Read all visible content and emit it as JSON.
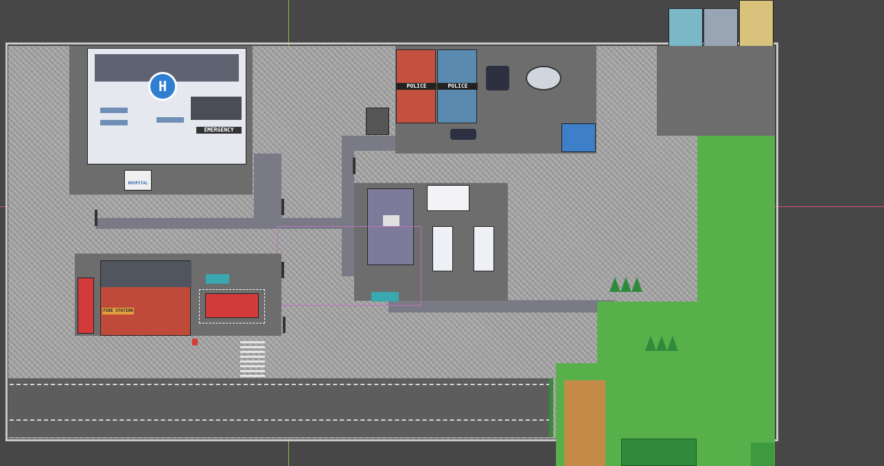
{
  "editor": {
    "canvas_bg": "#474747",
    "cursor_h_color": "#e0507a",
    "cursor_v_color": "#8ac24a"
  },
  "map": {
    "signs": {
      "hospital_helipad": "H",
      "emergency": "EMERGENCY",
      "hospital": "HOSPITAL",
      "police_left": "POLICE",
      "police_right": "POLICE",
      "fire_station": "FIRE STATION"
    },
    "icons": [
      "helicopter-icon",
      "mailbox-icon",
      "fire-hydrant-icon",
      "street-lamp-icon",
      "tree-icon",
      "police-car-icon",
      "fire-truck-icon",
      "mail-truck-icon"
    ]
  }
}
